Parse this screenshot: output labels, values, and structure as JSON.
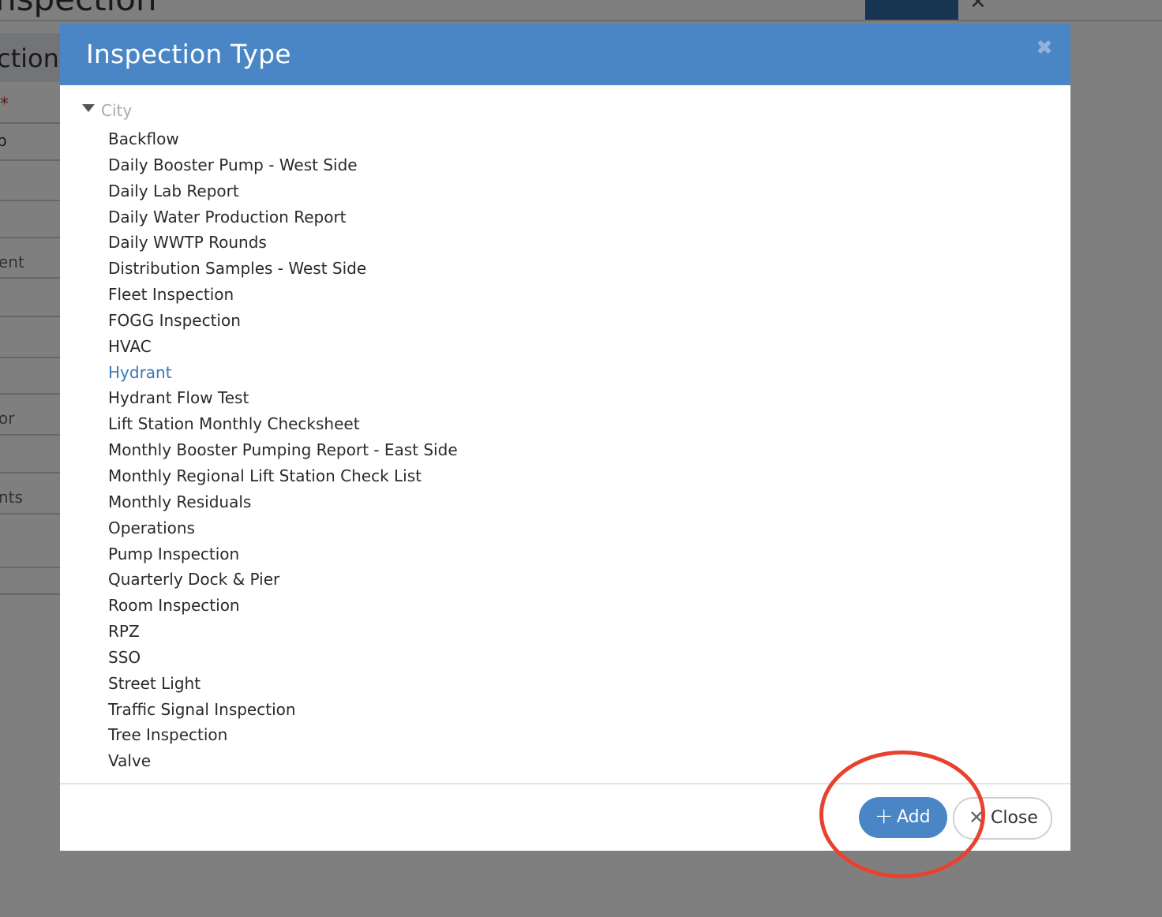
{
  "background": {
    "page_title": "nspection",
    "section_heading": "ction",
    "required_marker": "*",
    "field_value": "p",
    "field_labels": [
      "ent",
      "or",
      "nts"
    ],
    "close_glyph": "✕"
  },
  "modal": {
    "title": "Inspection Type",
    "close_glyph": "✖",
    "tree": {
      "root_label": "City",
      "items": [
        "Backflow",
        "Daily Booster Pump - West Side",
        "Daily Lab Report",
        "Daily Water Production Report",
        "Daily WWTP Rounds",
        "Distribution Samples - West Side",
        "Fleet Inspection",
        "FOGG Inspection",
        "HVAC",
        "Hydrant",
        "Hydrant Flow Test",
        "Lift Station Monthly Checksheet",
        "Monthly Booster Pumping Report - East Side",
        "Monthly Regional Lift Station Check List",
        "Monthly Residuals",
        "Operations",
        "Pump Inspection",
        "Quarterly Dock & Pier",
        "Room Inspection",
        "RPZ",
        "SSO",
        "Street Light",
        "Traffic Signal Inspection",
        "Tree Inspection",
        "Valve"
      ],
      "selected_item": "Hydrant"
    },
    "footer": {
      "add_icon": "+",
      "add_label": "Add",
      "close_icon": "✕",
      "close_label": "Close"
    }
  },
  "colors": {
    "header_blue": "#4a86c5",
    "selected_text": "#3b78b8",
    "annotation_red": "#e8422f"
  }
}
